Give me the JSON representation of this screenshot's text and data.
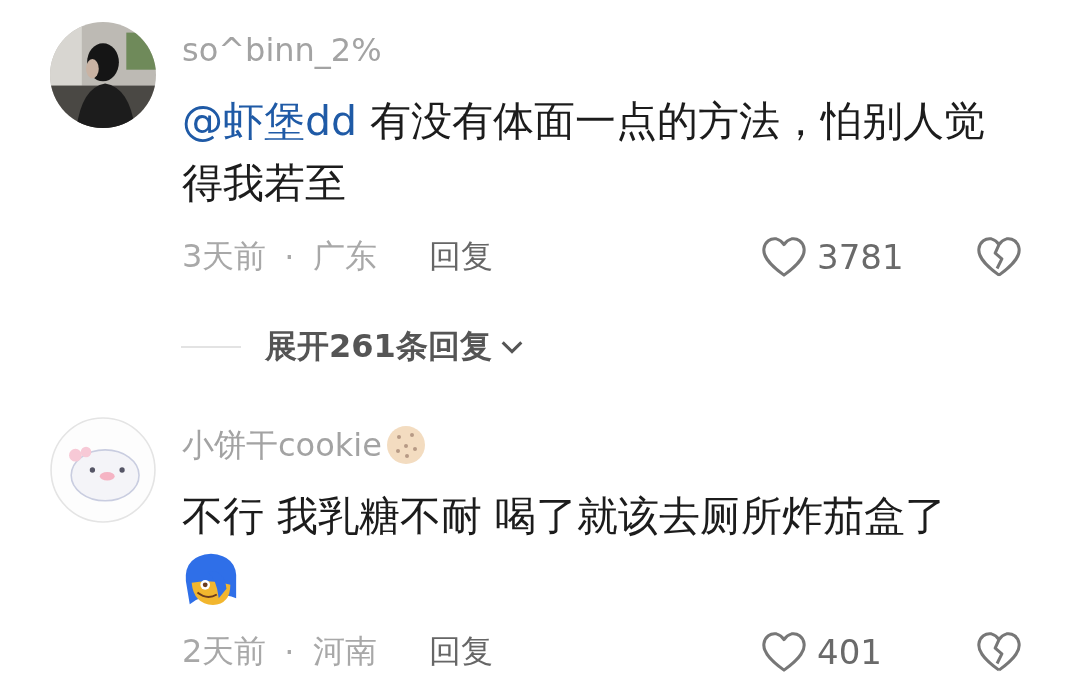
{
  "comments": [
    {
      "username": "so^binn_2%",
      "name_emoji": false,
      "mention": "@虾堡dd",
      "text": "有没有体面一点的方法，怕别人觉得我若至",
      "sticker": false,
      "time": "3天前",
      "separator": "·",
      "location": "广东",
      "reply_label": "回复",
      "likes": "3781",
      "expand_label": "展开261条回复"
    },
    {
      "username": "小饼干cookie",
      "name_emoji": true,
      "text": "不行 我乳糖不耐 喝了就该去厕所炸茄盒了",
      "sticker": true,
      "time": "2天前",
      "separator": "·",
      "location": "河南",
      "reply_label": "回复",
      "likes": "401"
    }
  ]
}
